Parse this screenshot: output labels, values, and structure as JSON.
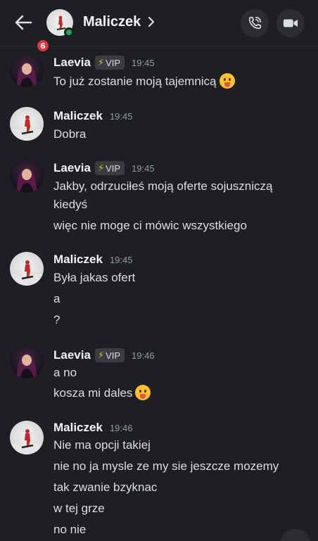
{
  "header": {
    "title": "Maliczek",
    "badge_count": "6",
    "status": "online",
    "icons": {
      "back": "arrow-left-icon",
      "chevron": "chevron-right-icon",
      "call": "phone-call-icon",
      "video": "video-camera-icon"
    }
  },
  "messages": [
    {
      "author": "Laevia",
      "vip": "VIP",
      "time": "19:45",
      "lines": [
        "To już zostanie moją tajemnicą"
      ]
    },
    {
      "author": "Maliczek",
      "time": "19:45",
      "lines": [
        "Dobra"
      ]
    },
    {
      "author": "Laevia",
      "vip": "VIP",
      "time": "19:45",
      "lines": [
        "Jakby, odrzuciłeś moją oferte sojuszniczą",
        "kiedyś",
        "więc nie moge ci mówic wszystkiego"
      ]
    },
    {
      "author": "Maliczek",
      "time": "19:45",
      "lines": [
        "Była jakas ofert",
        "a",
        "?"
      ]
    },
    {
      "author": "Laevia",
      "vip": "VIP",
      "time": "19:46",
      "lines": [
        "a no",
        "kosza mi dales"
      ]
    },
    {
      "author": "Maliczek",
      "time": "19:46",
      "lines": [
        "Nie ma opcji takiej",
        "nie no ja mysle ze my sie jeszcze mozemy",
        "tak zwanie bzyknac",
        "w tej grze",
        "no nie"
      ]
    }
  ],
  "emoji": "face-with-tongue-emoji",
  "colors": {
    "background": "#1e1f22",
    "online": "#23a55a",
    "badge": "#da373c",
    "vip_bolt": "#f0b232"
  }
}
